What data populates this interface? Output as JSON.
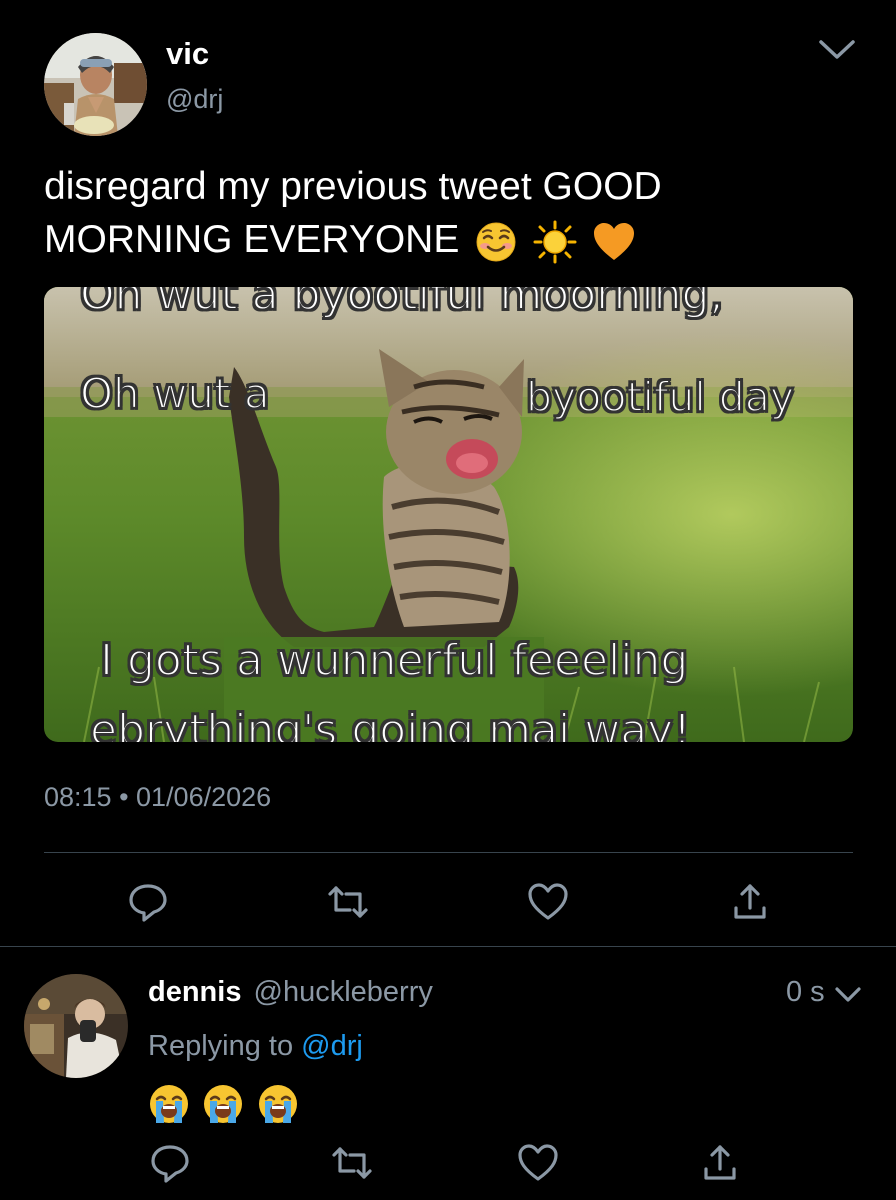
{
  "tweet": {
    "author_name": "vic",
    "author_handle": "@drj",
    "text": "disregard my previous tweet GOOD MORNING EVERYONE",
    "text_emojis": [
      "smiling-face-icon",
      "sun-icon",
      "orange-heart-icon"
    ],
    "media": {
      "caption_lines": [
        "Oh wut a byootiful moorning,",
        "Oh wut a",
        "byootiful day",
        "I gots a wunnerful feeeling",
        "ebrything's going mai way!"
      ]
    },
    "timestamp": "08:15 • 01/06/2026",
    "actions": [
      "reply-icon",
      "retweet-icon",
      "like-icon",
      "share-icon"
    ]
  },
  "reply": {
    "author_name": "dennis",
    "author_handle": "@huckleberry",
    "time": "0 s",
    "replying_prefix": "Replying to",
    "replying_handle": "@drj",
    "emojis": [
      "crying-face-icon",
      "crying-face-icon",
      "crying-face-icon"
    ],
    "actions": [
      "reply-icon",
      "retweet-icon",
      "like-icon",
      "share-icon"
    ]
  },
  "colors": {
    "background": "#000000",
    "text_primary": "#ffffff",
    "text_secondary": "#8b98a5",
    "link": "#1d9bf0",
    "divider": "#38444d"
  }
}
